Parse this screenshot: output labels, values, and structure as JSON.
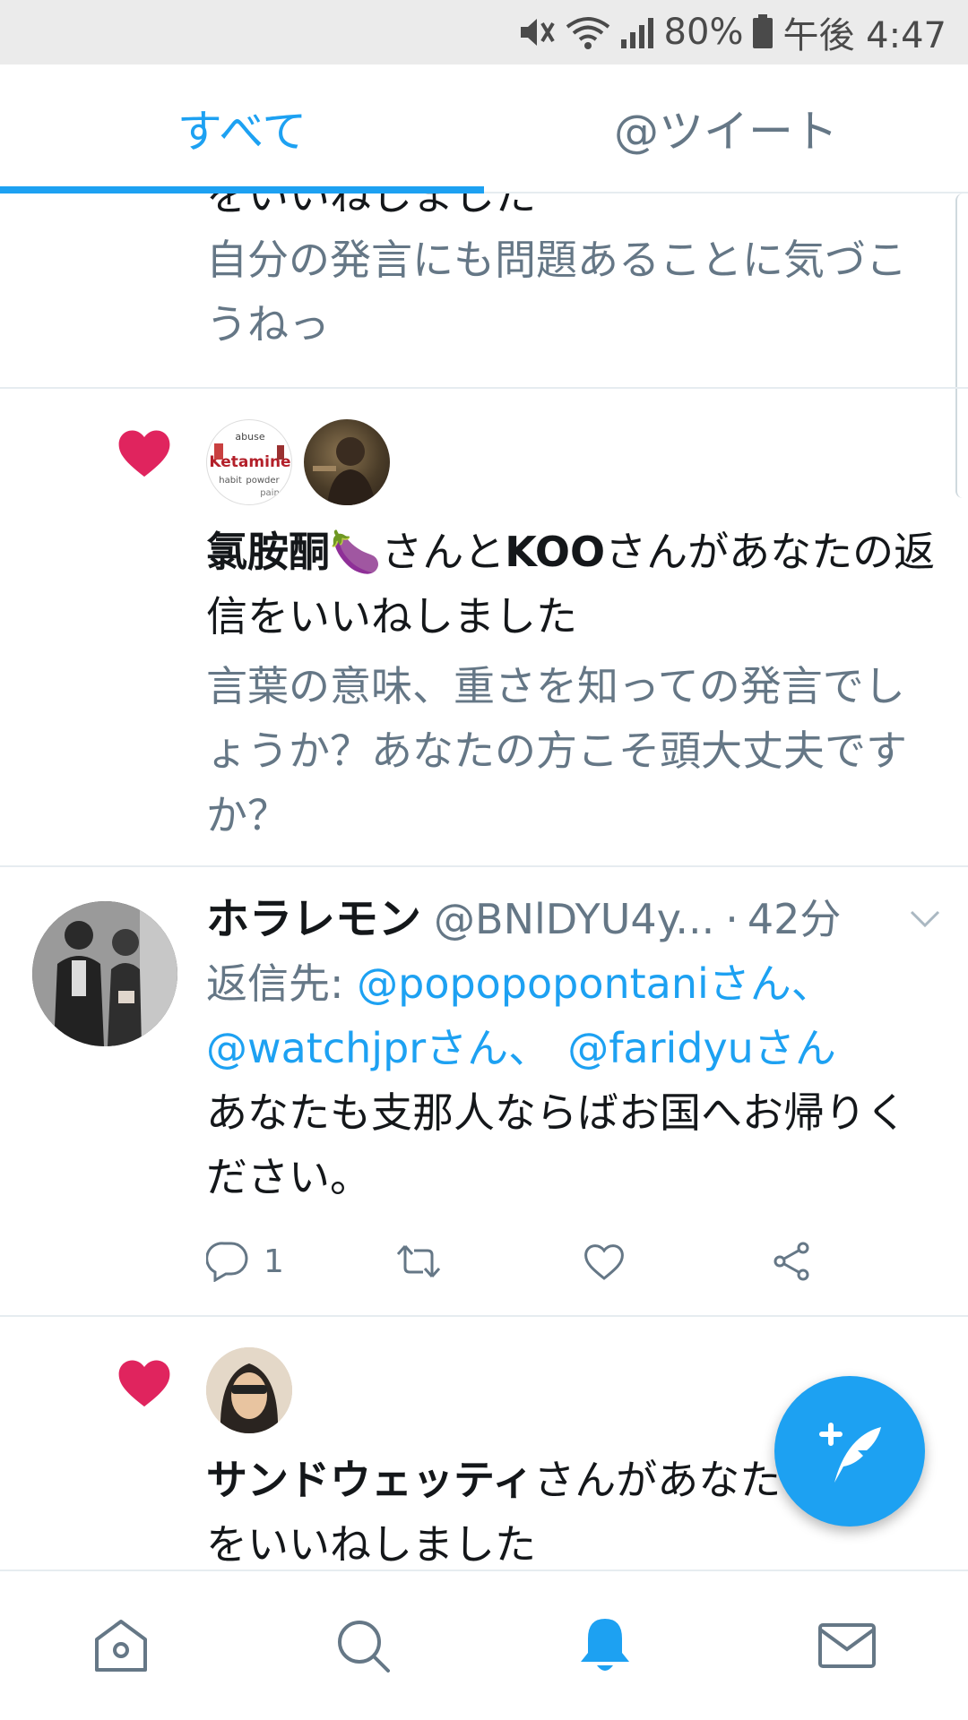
{
  "status_bar": {
    "battery": "80%",
    "time": "午後 4:47"
  },
  "tabs": [
    {
      "label": "すべて",
      "active": true
    },
    {
      "label": "@ツイート",
      "active": false
    }
  ],
  "items": [
    {
      "kind": "like_partial",
      "partial_line": "をいいねしました",
      "quote": "自分の発言にも問題あることに気づこうねっ"
    },
    {
      "kind": "like",
      "icon": "heart-icon",
      "avatar_texts": [
        "abuse",
        "Ketamine",
        "habit",
        "powder",
        "pain"
      ],
      "user1": "氯胺酮🍆",
      "connector": "さんと",
      "user2": "KOO",
      "suffix": "さんがあなたの返信をいいねしました",
      "quote": "言葉の意味、重さを知っての発言でしょうか？あなたの方こそ頭大丈夫ですか？"
    },
    {
      "kind": "tweet",
      "name": "ホラレモン",
      "handle": "@BNlDYU4y...",
      "dot": "·",
      "time": "42分",
      "reply_prefix": "返信先: ",
      "mentions": [
        "@popopopontaniさん、",
        "@watchjprさん、",
        "@faridyuさん"
      ],
      "body": "あなたも支那人ならばお国へお帰りください。",
      "reply_count": "1"
    },
    {
      "kind": "like",
      "icon": "heart-icon",
      "user1": "サンドウェッティ",
      "suffix": "さんがあなたの返信をいいねしました"
    }
  ],
  "colors": {
    "accent": "#1da1f2",
    "heart": "#e0245e",
    "secondary_text": "#657786"
  }
}
